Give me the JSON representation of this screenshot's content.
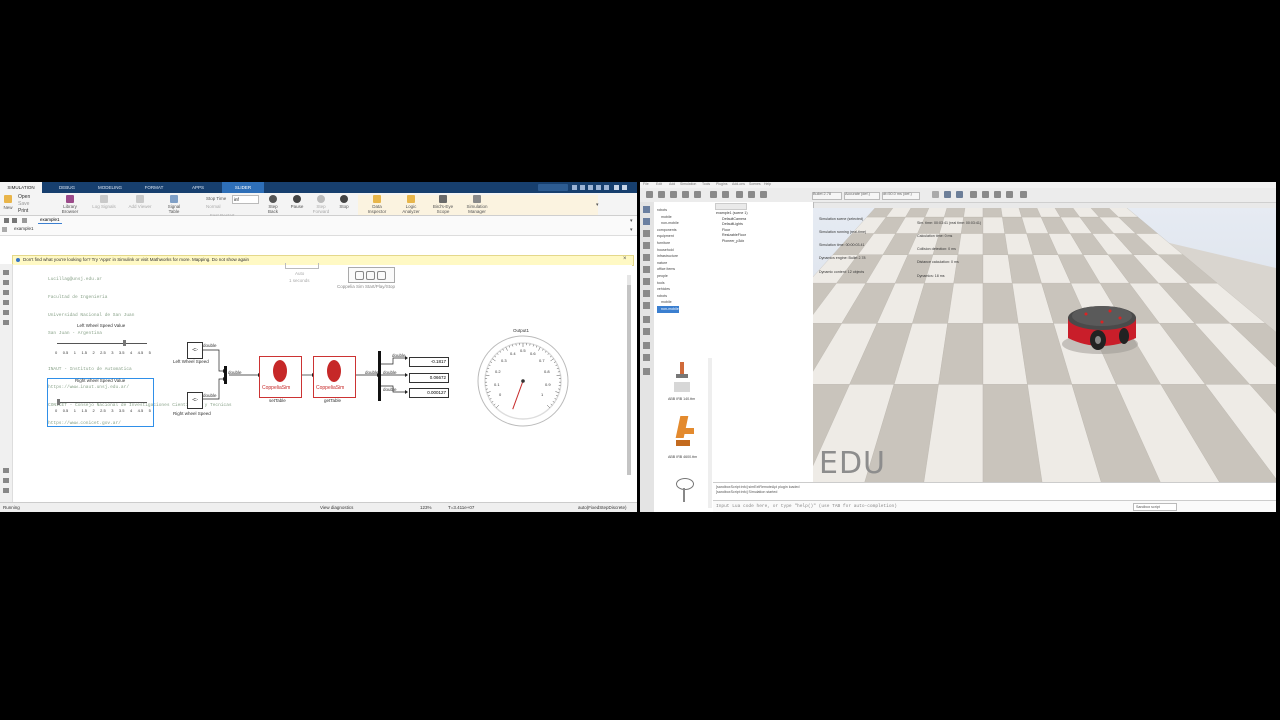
{
  "simulink": {
    "tabs": [
      "SIMULATION",
      "DEBUG",
      "MODELING",
      "FORMAT",
      "APPS",
      "SLIDER"
    ],
    "ribbon": {
      "file": [
        "Open",
        "Save",
        "Print"
      ],
      "new_label": "New",
      "file_section": "FILE",
      "library_browser": "Library Browser",
      "library_section": "LIBRARY",
      "log_signals": "Log Signals",
      "add_viewer": "Add Viewer",
      "signal_table": "Signal Table",
      "prepare_section": "PREPARE",
      "stop_time_label": "Stop Time",
      "stop_time_value": "inf",
      "mode_value": "Normal",
      "fast_restart": "Fast Restart",
      "step_back": "Step Back",
      "pause": "Pause",
      "step_forward": "Step Forward",
      "stop": "Stop",
      "simulate_section": "SIMULATE",
      "data_inspector": "Data Inspector",
      "logic_analyzer": "Logic Analyzer",
      "bird_eye_scope": "Bird's-Eye Scope",
      "simulation_manager": "Simulation Manager",
      "review_section": "REVIEW RESULTS"
    },
    "breadcrumb": "example1",
    "model_tab": "example1",
    "warning": "Don't find what you're looking for? Try 'Apps' in Simulink or visit Mathworks for more. Mapping. Do not show again",
    "header_lines": [
      "Lucillag@unsj.edu.ar",
      "Facultad de Ingenieria",
      "Universidad Nacional de San Juan",
      "San Juan - Argentina",
      "",
      "INAUT - Instituto de Automatica",
      "https://www.inaut.unsj.edu.ar/",
      "CONICET - Consejo Nacional de Investigaciones Cientificas y Tecnicas",
      "https://www.conicet.gov.ar/"
    ],
    "auto_label": "Auto",
    "auto_sub": "1 seconds",
    "coppelia_block_label": "Coppelia Sim Start/Play/Stop",
    "left_slider_title": "Left Wheel Speed Value",
    "right_slider_title": "Right wheel Speed Value",
    "slider_ticks": [
      "0",
      "0.5",
      "1",
      "1.5",
      "2",
      "2.5",
      "3",
      "3.5",
      "4",
      "4.5",
      "5"
    ],
    "const_label": "-C-",
    "left_block_label": "Left Wheel Speed",
    "right_block_label": "Right wheel Speed",
    "double_label": "double",
    "coppelia_logo_text": "CoppeliaSim",
    "set_table": "setTable",
    "get_table": "getTable",
    "display_values": [
      "-0.1817",
      "0.06672",
      "0.000127"
    ],
    "gauge_title": "Output1",
    "gauge_ticks": [
      "0",
      "0.1",
      "0.2",
      "0.3",
      "0.4",
      "0.5",
      "0.6",
      "0.7",
      "0.8",
      "0.9",
      "1"
    ],
    "status": {
      "left": "Running",
      "center": "View diagnostics",
      "zoom": "123%",
      "time": "T=3.411e+07",
      "solver": "auto(FixedStepDiscrete)"
    }
  },
  "coppelia": {
    "menu": [
      "File",
      "Edit",
      "Add",
      "Simulation",
      "Tools",
      "Plugins",
      "Add-ons",
      "Scenes",
      "Help"
    ],
    "engine": "Bullet 2.78",
    "accuracy": "Accurate (def.)",
    "dt": "dt=50.0 ms (def.)",
    "models_tree": [
      "robots",
      "mobile",
      "non-mobile",
      "components",
      "equipment",
      "furniture",
      "household",
      "infrastructure",
      "nature",
      "office items",
      "people",
      "tools",
      "vehicles",
      "robots",
      "mobile",
      "non-mobile"
    ],
    "scene_tree": [
      "example1 (scene 1)",
      "DefaultCamera",
      "DefaultLights",
      "Floor",
      "ResizableFloor",
      "Pioneer_p3dx"
    ],
    "robot_thumbs": [
      "ABB IRB 140.ttm",
      "ABB IRB 4600.ttm",
      ""
    ],
    "overlay_left": [
      "Simulation scene (selected)",
      "Simulation running (real-time)",
      "Simulation time: 00:00:03.41",
      "Dynamics engine: Bullet 2.78",
      "Dynamic content: 12 objects"
    ],
    "overlay_right": [
      "Sim. time: 00:03:41 (real time: 00:03:41)",
      "Calculation time: 0 ms",
      "Collision detection: 0 ms",
      "Distance calculation: 0 ms",
      "Dynamics: 18 ms"
    ],
    "edu": "EDU",
    "console_lines": [
      "[sandboxScript:info] simExtRemoteApi plugin loaded",
      "[sandboxScript:info] Simulation started"
    ],
    "input_placeholder": "Input Lua code here, or type \"help()\" (use TAB for auto-completion)",
    "sandbox": "Sandbox script"
  }
}
